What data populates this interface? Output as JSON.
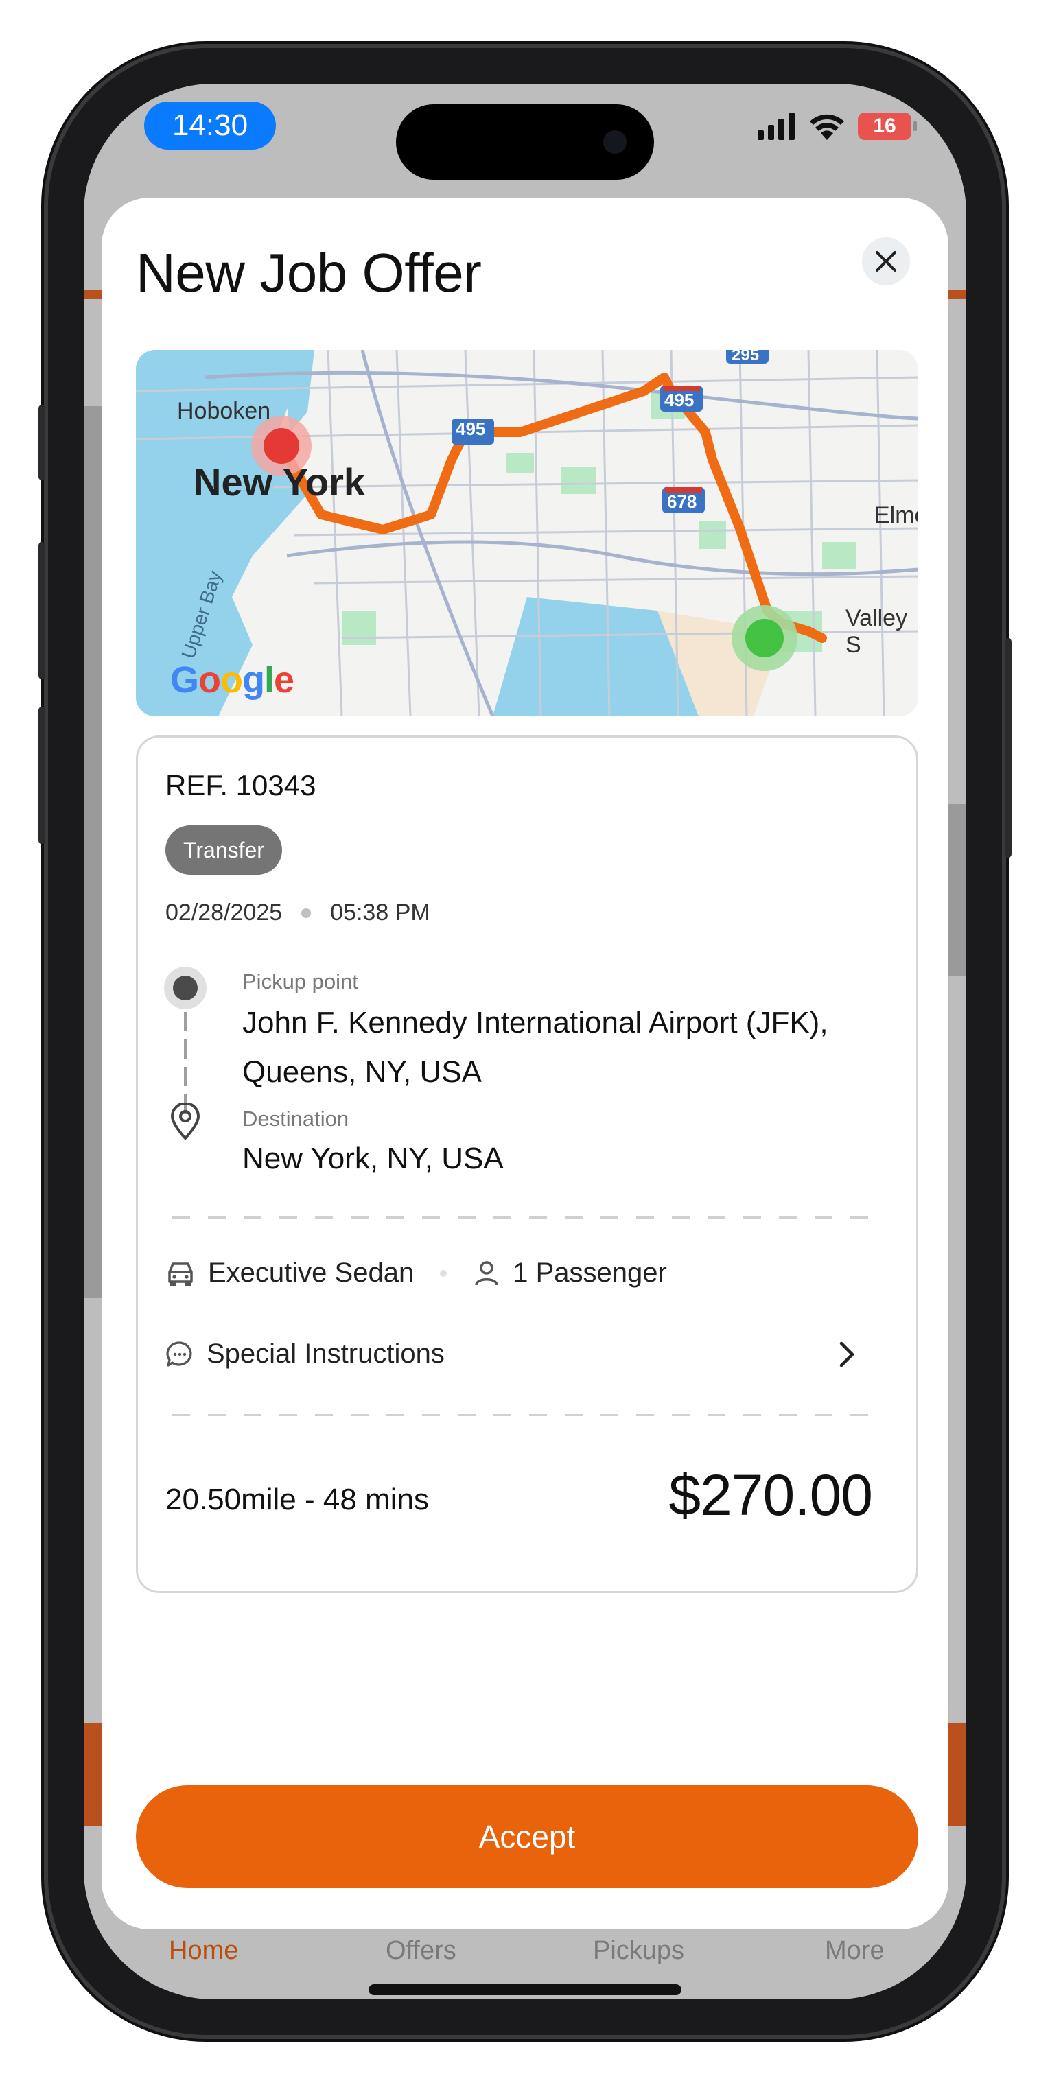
{
  "status_bar": {
    "time": "14:30",
    "battery": "16"
  },
  "modal": {
    "title": "New Job Offer",
    "map": {
      "labels": [
        "Hoboken",
        "New York",
        "Elmo",
        "Valley S",
        "Upper Bay",
        "495",
        "495",
        "678",
        "295"
      ],
      "logo": "Google"
    },
    "job": {
      "ref": "REF. 10343",
      "type_badge": "Transfer",
      "date": "02/28/2025",
      "time": "05:38 PM",
      "pickup_label": "Pickup point",
      "pickup_value": "John F. Kennedy International Airport (JFK), Queens, NY, USA",
      "destination_label": "Destination",
      "destination_value": "New York, NY, USA",
      "vehicle": "Executive Sedan",
      "passengers": "1 Passenger",
      "special_instructions": "Special Instructions",
      "trip_info": "20.50mile - 48 mins",
      "price": "$270.00"
    },
    "accept_label": "Accept"
  },
  "tabbar": {
    "items": [
      {
        "label": "Home",
        "active": true
      },
      {
        "label": "Offers",
        "active": false
      },
      {
        "label": "Pickups",
        "active": false
      },
      {
        "label": "More",
        "active": false
      }
    ]
  },
  "colors": {
    "accent": "#e9620c",
    "route": "#f06c14",
    "pickup_marker": "#e53935",
    "dropoff_marker": "#43c143",
    "time_pill": "#0a7aff"
  },
  "icons": {
    "close": "close-icon",
    "pickup": "pickup-dot-icon",
    "destination": "location-pin-icon",
    "vehicle": "car-icon",
    "passenger": "person-icon",
    "instructions": "chat-bubble-icon",
    "chevron": "chevron-right-icon"
  }
}
